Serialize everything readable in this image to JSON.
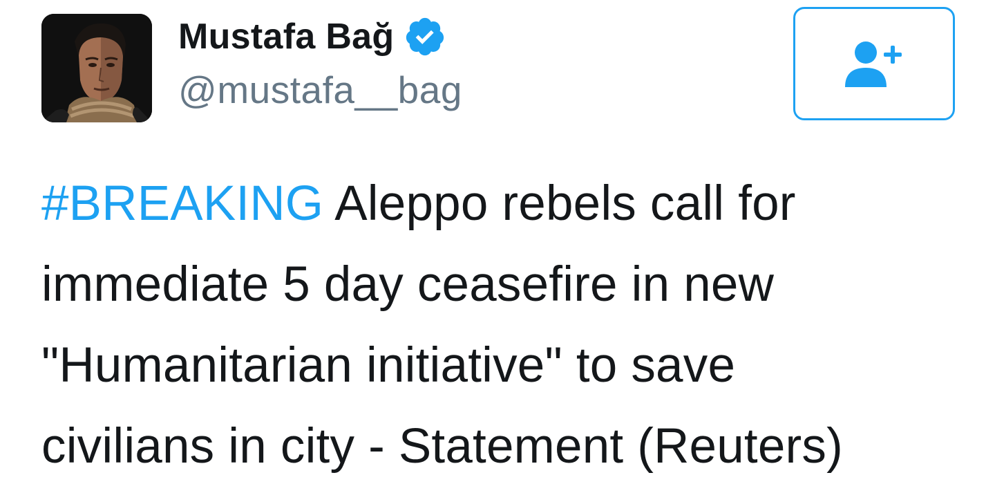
{
  "author": {
    "display_name": "Mustafa Bağ",
    "handle": "@mustafa__bag",
    "verified": true,
    "avatar_icon": "profile-photo"
  },
  "follow_button": {
    "icon": "follow-user-plus-icon",
    "color": "#1da1f2"
  },
  "tweet": {
    "hashtag": "#BREAKING",
    "line1_rest": " Aleppo rebels call for",
    "line2": "immediate 5 day ceasefire in new",
    "line3": "\"Humanitarian initiative\" to save",
    "line4": "civilians in city - Statement (Reuters)"
  },
  "colors": {
    "accent": "#1da1f2",
    "text": "#14171a",
    "muted": "#657786"
  }
}
